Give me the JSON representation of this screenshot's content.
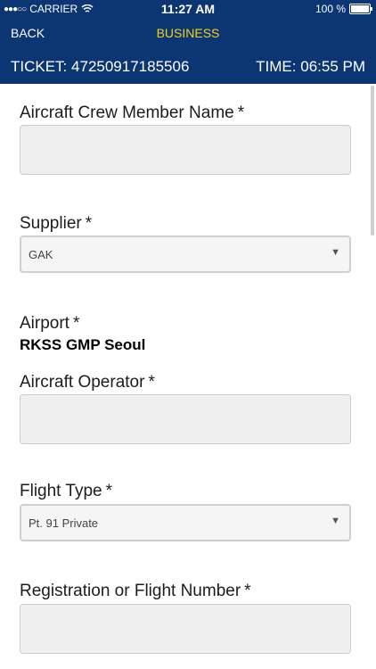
{
  "status_bar": {
    "signal_dots": "●●●○○",
    "carrier": "CARRIER",
    "time": "11:27 AM",
    "battery": "100 %"
  },
  "nav": {
    "back_label": "BACK",
    "title": "BUSINESS",
    "ticket_label": "TICKET:",
    "ticket_value": "47250917185506",
    "time_label": "TIME:",
    "time_value": "06:55 PM"
  },
  "form": {
    "crew_name_label": "Aircraft Crew Member Name",
    "supplier_label": "Supplier",
    "supplier_value": "GAK",
    "airport_label": "Airport",
    "airport_value": "RKSS GMP Seoul",
    "operator_label": "Aircraft Operator",
    "flight_type_label": "Flight Type",
    "flight_type_value": "Pt. 91 Private",
    "registration_label": "Registration or Flight Number",
    "required_marker": "*"
  },
  "icons": {
    "wifi": "wifi-icon",
    "battery": "battery-icon",
    "dropdown": "chevron-down-icon"
  }
}
